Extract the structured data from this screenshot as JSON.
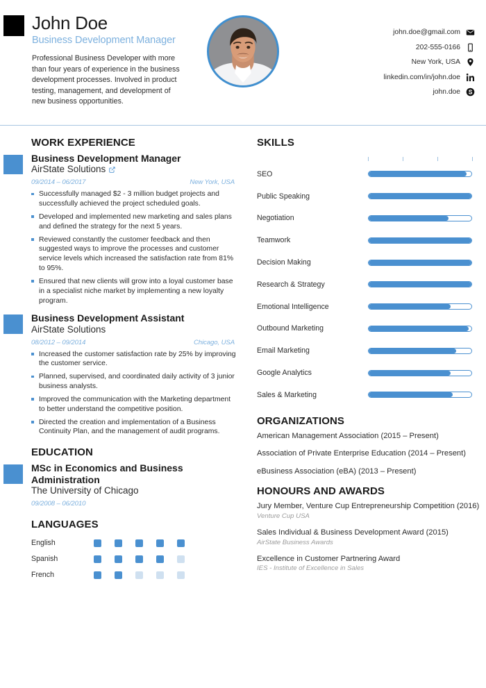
{
  "header": {
    "name": "John Doe",
    "job_title": "Business Development Manager",
    "summary": "Professional Business Developer with more than four years of experience in the business development processes. Involved in product testing, management, and development of new business opportunities.",
    "photo_alt": "portrait-photo",
    "contacts": [
      {
        "text": "john.doe@gmail.com",
        "icon": "envelope-icon"
      },
      {
        "text": "202-555-0166",
        "icon": "phone-icon"
      },
      {
        "text": "New York, USA",
        "icon": "location-pin-icon"
      },
      {
        "text": "linkedin.com/in/john.doe",
        "icon": "linkedin-icon"
      },
      {
        "text": "john.doe",
        "icon": "skype-icon"
      }
    ]
  },
  "work_experience": {
    "title": "WORK EXPERIENCE",
    "entries": [
      {
        "role": "Business Development Manager",
        "company": "AirState Solutions",
        "has_link": true,
        "dates": "09/2014 – 06/2017",
        "location": "New York, USA",
        "bullets": [
          "Successfully managed $2 - 3 million budget projects and successfully achieved the project scheduled goals.",
          "Developed and implemented new marketing and sales plans and defined the strategy for the next 5 years.",
          "Reviewed constantly the customer feedback and then suggested ways to improve the processes and customer service levels which increased the satisfaction rate from 81% to 95%.",
          "Ensured that new clients will grow into a loyal customer base in a specialist niche market by implementing a new loyalty program."
        ]
      },
      {
        "role": "Business Development Assistant",
        "company": "AirState Solutions",
        "has_link": false,
        "dates": "08/2012 – 09/2014",
        "location": "Chicago, USA",
        "bullets": [
          "Increased the customer satisfaction rate by 25% by improving the customer service.",
          "Planned, supervised, and coordinated daily activity of 3 junior business analysts.",
          "Improved the communication with the Marketing department to better understand the competitive position.",
          "Directed the creation and implementation of a Business Continuity Plan, and the management of audit programs."
        ]
      }
    ]
  },
  "education": {
    "title": "EDUCATION",
    "entries": [
      {
        "degree": "MSc in Economics and Business Administration",
        "school": "The University of Chicago",
        "dates": "09/2008 – 06/2010"
      }
    ]
  },
  "languages": {
    "title": "LANGUAGES",
    "max_level": 5,
    "items": [
      {
        "name": "English",
        "level": 5
      },
      {
        "name": "Spanish",
        "level": 4
      },
      {
        "name": "French",
        "level": 2
      }
    ]
  },
  "skills": {
    "title": "SKILLS",
    "tick_count": 4,
    "items": [
      {
        "name": "SEO",
        "level": 95
      },
      {
        "name": "Public Speaking",
        "level": 100
      },
      {
        "name": "Negotiation",
        "level": 78
      },
      {
        "name": "Teamwork",
        "level": 100
      },
      {
        "name": "Decision Making",
        "level": 100
      },
      {
        "name": "Research & Strategy",
        "level": 100
      },
      {
        "name": "Emotional Intelligence",
        "level": 80
      },
      {
        "name": "Outbound Marketing",
        "level": 97
      },
      {
        "name": "Email Marketing",
        "level": 85
      },
      {
        "name": "Google Analytics",
        "level": 80
      },
      {
        "name": "Sales & Marketing",
        "level": 82
      }
    ]
  },
  "organizations": {
    "title": "ORGANIZATIONS",
    "items": [
      {
        "main": "American Management Association (2015 – Present)",
        "sub": ""
      },
      {
        "main": "Association of Private Enterprise Education (2014 – Present)",
        "sub": ""
      },
      {
        "main": "eBusiness Association (eBA) (2013 – Present)",
        "sub": ""
      }
    ]
  },
  "honours": {
    "title": "HONOURS AND AWARDS",
    "items": [
      {
        "main": "Jury Member, Venture Cup Entrepreneurship Competition (2016)",
        "sub": "Venture Cup USA"
      },
      {
        "main": "Sales Individual & Business Development Award (2015)",
        "sub": "AirState Business Awards"
      },
      {
        "main": "Excellence in Customer Partnering Award",
        "sub": "IES - Institute of Excellence in Sales"
      }
    ]
  },
  "theme": {
    "accent_blue": "#4a90d0",
    "light_blue": "#7cb0de",
    "empty_dot": "#cfe0f0",
    "text": "#2b2b2b"
  }
}
